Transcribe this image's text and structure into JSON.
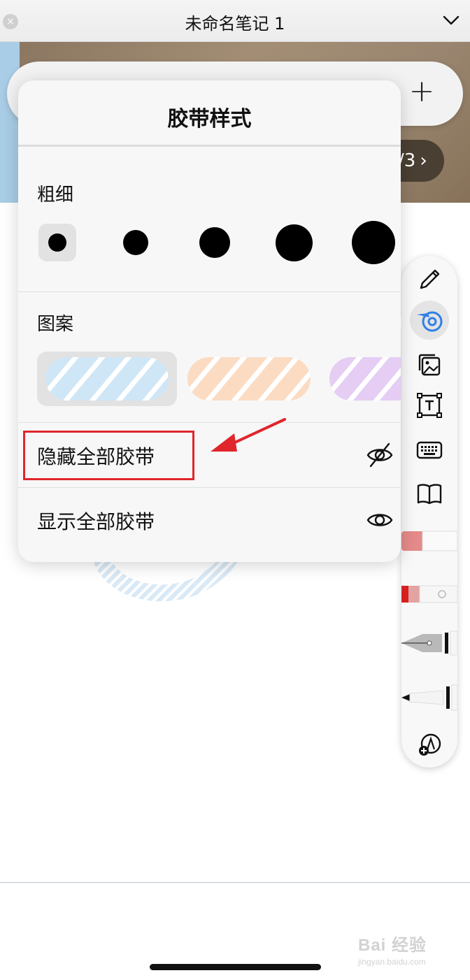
{
  "titlebar": {
    "title": "未命名笔记 1",
    "close_icon": "×"
  },
  "page_indicator": {
    "text": "/3",
    "arrow": "›"
  },
  "top_toolbar": {
    "add_label": "+"
  },
  "popover": {
    "title": "胶带样式",
    "thickness_label": "粗细",
    "thickness_options": [
      {
        "size": "xs",
        "selected": true
      },
      {
        "size": "s",
        "selected": false
      },
      {
        "size": "m",
        "selected": false
      },
      {
        "size": "l",
        "selected": false
      },
      {
        "size": "xl",
        "selected": false
      }
    ],
    "pattern_label": "图案",
    "patterns": [
      {
        "name": "blue-stripes",
        "color": "#cfe6f7",
        "selected": true
      },
      {
        "name": "orange-stripes",
        "color": "#fbdcc3",
        "selected": false
      },
      {
        "name": "purple-stripes",
        "color": "#e5cdf4",
        "selected": false
      }
    ],
    "hide_all_label": "隐藏全部胶带",
    "show_all_label": "显示全部胶带"
  },
  "palette": {
    "tools": [
      "pencil-icon",
      "tape-icon",
      "image-icon",
      "text-box-icon",
      "keyboard-icon",
      "book-icon",
      "eraser-icon",
      "lasso-eraser-icon",
      "fountain-pen-icon",
      "marker-icon",
      "add-tool-icon"
    ],
    "active_tool": "tape-icon",
    "accent": "#2f80e8"
  },
  "watermark": {
    "main": "Bai 经验",
    "sub": "jingyan.baidu.com"
  },
  "annotation": {
    "highlight_color": "#e0262c"
  }
}
